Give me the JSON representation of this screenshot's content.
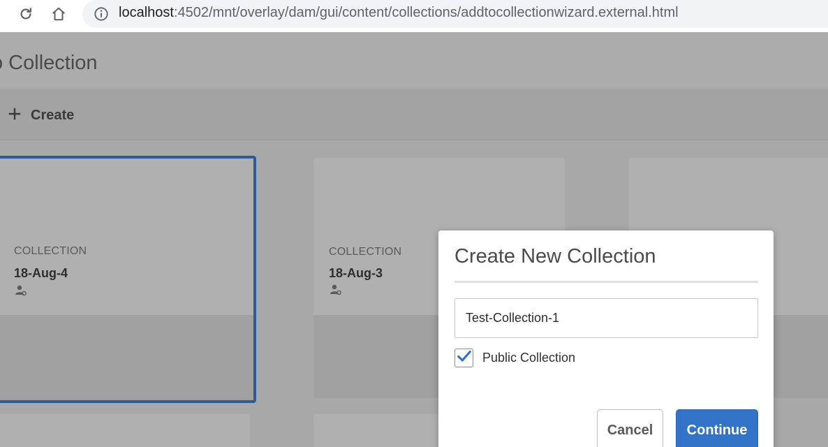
{
  "browser": {
    "url_host": "localhost",
    "url_path": ":4502/mnt/overlay/dam/gui/content/collections/addtocollectionwizard.external.html",
    "reload_icon": "reload-icon",
    "home_icon": "home-icon",
    "info_icon": "info-icon"
  },
  "page": {
    "title": "o Collection",
    "toolbar": {
      "create_label": "Create",
      "create_icon": "plus-icon"
    }
  },
  "cards": [
    {
      "type": "COLLECTION",
      "name": "18-Aug-4",
      "icon": "user-share-icon",
      "selected": true
    },
    {
      "type": "COLLECTION",
      "name": "18-Aug-3",
      "icon": "user-share-icon",
      "selected": false
    },
    {
      "type": "",
      "name": "",
      "selected": false
    }
  ],
  "dialog": {
    "title": "Create New Collection",
    "name_value": "Test-Collection-1",
    "public_label": "Public Collection",
    "public_checked": true,
    "cancel_label": "Cancel",
    "continue_label": "Continue"
  },
  "colors": {
    "accent": "#3273c8",
    "selected_border": "#2f5a97",
    "checkmark": "#2f6fd1"
  }
}
